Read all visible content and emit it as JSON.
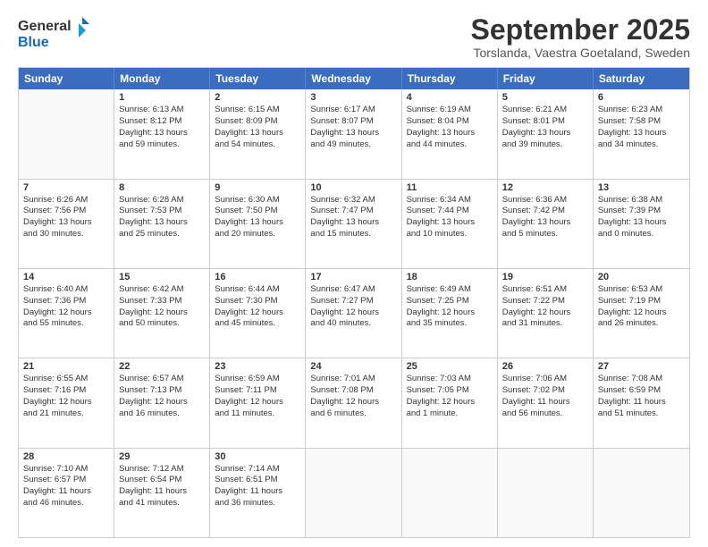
{
  "header": {
    "logo_general": "General",
    "logo_blue": "Blue",
    "month": "September 2025",
    "location": "Torslanda, Vaestra Goetaland, Sweden"
  },
  "weekdays": [
    "Sunday",
    "Monday",
    "Tuesday",
    "Wednesday",
    "Thursday",
    "Friday",
    "Saturday"
  ],
  "weeks": [
    [
      {
        "day": "",
        "empty": true
      },
      {
        "day": "1",
        "lines": [
          "Sunrise: 6:13 AM",
          "Sunset: 8:12 PM",
          "Daylight: 13 hours",
          "and 59 minutes."
        ]
      },
      {
        "day": "2",
        "lines": [
          "Sunrise: 6:15 AM",
          "Sunset: 8:09 PM",
          "Daylight: 13 hours",
          "and 54 minutes."
        ]
      },
      {
        "day": "3",
        "lines": [
          "Sunrise: 6:17 AM",
          "Sunset: 8:07 PM",
          "Daylight: 13 hours",
          "and 49 minutes."
        ]
      },
      {
        "day": "4",
        "lines": [
          "Sunrise: 6:19 AM",
          "Sunset: 8:04 PM",
          "Daylight: 13 hours",
          "and 44 minutes."
        ]
      },
      {
        "day": "5",
        "lines": [
          "Sunrise: 6:21 AM",
          "Sunset: 8:01 PM",
          "Daylight: 13 hours",
          "and 39 minutes."
        ]
      },
      {
        "day": "6",
        "lines": [
          "Sunrise: 6:23 AM",
          "Sunset: 7:58 PM",
          "Daylight: 13 hours",
          "and 34 minutes."
        ]
      }
    ],
    [
      {
        "day": "7",
        "lines": [
          "Sunrise: 6:26 AM",
          "Sunset: 7:56 PM",
          "Daylight: 13 hours",
          "and 30 minutes."
        ]
      },
      {
        "day": "8",
        "lines": [
          "Sunrise: 6:28 AM",
          "Sunset: 7:53 PM",
          "Daylight: 13 hours",
          "and 25 minutes."
        ]
      },
      {
        "day": "9",
        "lines": [
          "Sunrise: 6:30 AM",
          "Sunset: 7:50 PM",
          "Daylight: 13 hours",
          "and 20 minutes."
        ]
      },
      {
        "day": "10",
        "lines": [
          "Sunrise: 6:32 AM",
          "Sunset: 7:47 PM",
          "Daylight: 13 hours",
          "and 15 minutes."
        ]
      },
      {
        "day": "11",
        "lines": [
          "Sunrise: 6:34 AM",
          "Sunset: 7:44 PM",
          "Daylight: 13 hours",
          "and 10 minutes."
        ]
      },
      {
        "day": "12",
        "lines": [
          "Sunrise: 6:36 AM",
          "Sunset: 7:42 PM",
          "Daylight: 13 hours",
          "and 5 minutes."
        ]
      },
      {
        "day": "13",
        "lines": [
          "Sunrise: 6:38 AM",
          "Sunset: 7:39 PM",
          "Daylight: 13 hours",
          "and 0 minutes."
        ]
      }
    ],
    [
      {
        "day": "14",
        "lines": [
          "Sunrise: 6:40 AM",
          "Sunset: 7:36 PM",
          "Daylight: 12 hours",
          "and 55 minutes."
        ]
      },
      {
        "day": "15",
        "lines": [
          "Sunrise: 6:42 AM",
          "Sunset: 7:33 PM",
          "Daylight: 12 hours",
          "and 50 minutes."
        ]
      },
      {
        "day": "16",
        "lines": [
          "Sunrise: 6:44 AM",
          "Sunset: 7:30 PM",
          "Daylight: 12 hours",
          "and 45 minutes."
        ]
      },
      {
        "day": "17",
        "lines": [
          "Sunrise: 6:47 AM",
          "Sunset: 7:27 PM",
          "Daylight: 12 hours",
          "and 40 minutes."
        ]
      },
      {
        "day": "18",
        "lines": [
          "Sunrise: 6:49 AM",
          "Sunset: 7:25 PM",
          "Daylight: 12 hours",
          "and 35 minutes."
        ]
      },
      {
        "day": "19",
        "lines": [
          "Sunrise: 6:51 AM",
          "Sunset: 7:22 PM",
          "Daylight: 12 hours",
          "and 31 minutes."
        ]
      },
      {
        "day": "20",
        "lines": [
          "Sunrise: 6:53 AM",
          "Sunset: 7:19 PM",
          "Daylight: 12 hours",
          "and 26 minutes."
        ]
      }
    ],
    [
      {
        "day": "21",
        "lines": [
          "Sunrise: 6:55 AM",
          "Sunset: 7:16 PM",
          "Daylight: 12 hours",
          "and 21 minutes."
        ]
      },
      {
        "day": "22",
        "lines": [
          "Sunrise: 6:57 AM",
          "Sunset: 7:13 PM",
          "Daylight: 12 hours",
          "and 16 minutes."
        ]
      },
      {
        "day": "23",
        "lines": [
          "Sunrise: 6:59 AM",
          "Sunset: 7:11 PM",
          "Daylight: 12 hours",
          "and 11 minutes."
        ]
      },
      {
        "day": "24",
        "lines": [
          "Sunrise: 7:01 AM",
          "Sunset: 7:08 PM",
          "Daylight: 12 hours",
          "and 6 minutes."
        ]
      },
      {
        "day": "25",
        "lines": [
          "Sunrise: 7:03 AM",
          "Sunset: 7:05 PM",
          "Daylight: 12 hours",
          "and 1 minute."
        ]
      },
      {
        "day": "26",
        "lines": [
          "Sunrise: 7:06 AM",
          "Sunset: 7:02 PM",
          "Daylight: 11 hours",
          "and 56 minutes."
        ]
      },
      {
        "day": "27",
        "lines": [
          "Sunrise: 7:08 AM",
          "Sunset: 6:59 PM",
          "Daylight: 11 hours",
          "and 51 minutes."
        ]
      }
    ],
    [
      {
        "day": "28",
        "lines": [
          "Sunrise: 7:10 AM",
          "Sunset: 6:57 PM",
          "Daylight: 11 hours",
          "and 46 minutes."
        ]
      },
      {
        "day": "29",
        "lines": [
          "Sunrise: 7:12 AM",
          "Sunset: 6:54 PM",
          "Daylight: 11 hours",
          "and 41 minutes."
        ]
      },
      {
        "day": "30",
        "lines": [
          "Sunrise: 7:14 AM",
          "Sunset: 6:51 PM",
          "Daylight: 11 hours",
          "and 36 minutes."
        ]
      },
      {
        "day": "",
        "empty": true
      },
      {
        "day": "",
        "empty": true
      },
      {
        "day": "",
        "empty": true
      },
      {
        "day": "",
        "empty": true
      }
    ]
  ]
}
